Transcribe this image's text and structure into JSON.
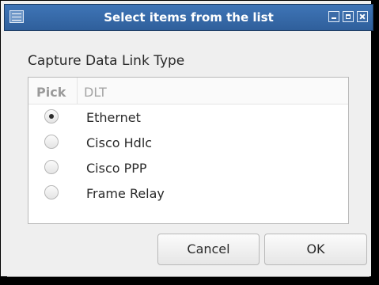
{
  "window": {
    "title": "Select items from the list",
    "controls": [
      "minimize",
      "maximize",
      "close"
    ]
  },
  "dialog": {
    "heading": "Capture Data Link Type",
    "columns": {
      "pick": "Pick",
      "dlt": "DLT"
    },
    "options": [
      {
        "label": "Ethernet",
        "selected": true
      },
      {
        "label": "Cisco Hdlc",
        "selected": false
      },
      {
        "label": "Cisco PPP",
        "selected": false
      },
      {
        "label": "Frame Relay",
        "selected": false
      }
    ],
    "buttons": {
      "cancel": "Cancel",
      "ok": "OK"
    }
  },
  "colors": {
    "titlebar": "#3f75b7",
    "background": "#efefef",
    "list_background": "#ffffff"
  },
  "icons": {
    "window_icon": "window-menu-icon",
    "minimize": "minimize-icon",
    "maximize": "maximize-icon",
    "close": "close-icon",
    "radio_selected": "radio-selected-icon",
    "radio_unselected": "radio-unselected-icon"
  }
}
